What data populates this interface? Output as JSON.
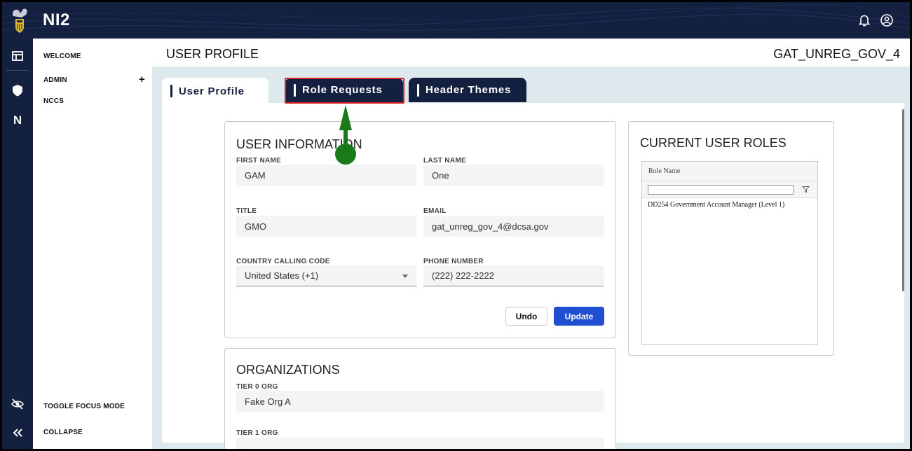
{
  "app": {
    "brand": "NI2"
  },
  "icons": {
    "logo": "agency-seal-logo",
    "bell": "bell-icon",
    "user": "user-circle-icon",
    "dashboard": "dashboard-icon",
    "shield": "shield-icon",
    "n": "n-letter-icon",
    "focus": "eye-slash-icon",
    "collapse": "double-chevron-left-icon"
  },
  "rail": {
    "n_label": "N"
  },
  "sidenav": {
    "items": [
      {
        "label": "WELCOME"
      },
      {
        "label": "ADMIN"
      },
      {
        "label": "NCCS"
      }
    ],
    "expand_label": "+",
    "toggle_focus": "TOGGLE FOCUS MODE",
    "collapse": "COLLAPSE"
  },
  "page": {
    "title": "USER PROFILE",
    "username": "GAT_UNREG_GOV_4"
  },
  "tabs": [
    {
      "label": "User Profile"
    },
    {
      "label": "Role Requests"
    },
    {
      "label": "Header Themes"
    }
  ],
  "user_info": {
    "title": "USER INFORMATION",
    "first_name_label": "FIRST NAME",
    "first_name": "GAM",
    "last_name_label": "LAST NAME",
    "last_name": "One",
    "title_label": "TITLE",
    "title_value": "GMO",
    "email_label": "EMAIL",
    "email": "gat_unreg_gov_4@dcsa.gov",
    "country_label": "COUNTRY CALLING CODE",
    "country": "United States (+1)",
    "phone_label": "PHONE NUMBER",
    "phone": "(222) 222-2222",
    "undo": "Undo",
    "update": "Update"
  },
  "organizations": {
    "title": "ORGANIZATIONS",
    "tier0_label": "TIER 0 ORG",
    "tier0": "Fake Org A",
    "tier1_label": "TIER 1 ORG"
  },
  "roles": {
    "title": "CURRENT USER ROLES",
    "column": "Role Name",
    "rows": [
      "DD254 Government Account Manager (Level 1)"
    ]
  },
  "colors": {
    "navy": "#14203f",
    "accent_blue": "#1f4fd0",
    "highlight_red": "#e0202a",
    "annotation_green": "#1a7a1a",
    "main_bg": "#dde9ec"
  }
}
